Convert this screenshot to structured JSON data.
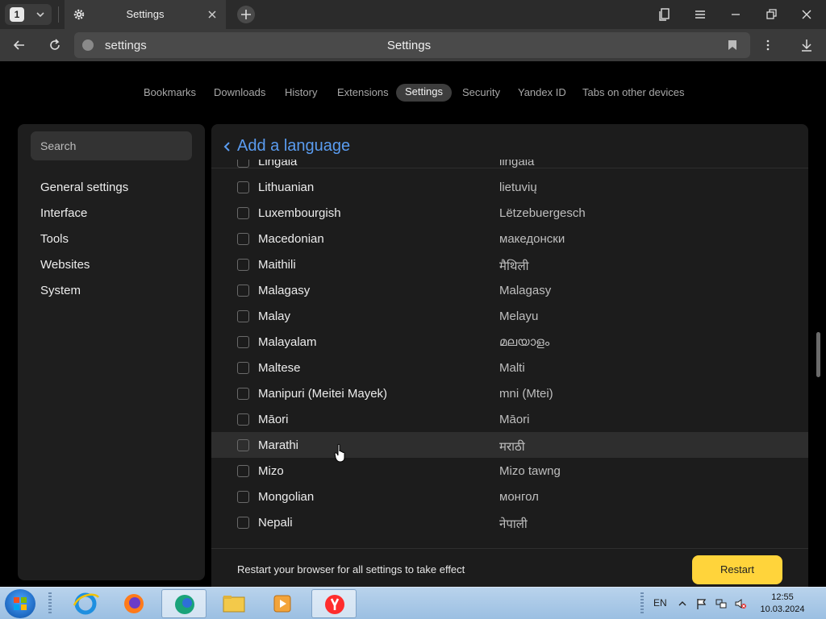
{
  "browser": {
    "tab_count": "1",
    "tab_title": "Settings",
    "url": "settings",
    "page_title": "Settings"
  },
  "topnav": {
    "items": [
      "Bookmarks",
      "Downloads",
      "History",
      "Extensions",
      "Settings",
      "Security",
      "Yandex ID",
      "Tabs on other devices"
    ],
    "active": "Settings"
  },
  "sidebar": {
    "search_placeholder": "Search",
    "items": [
      "General settings",
      "Interface",
      "Tools",
      "Websites",
      "System"
    ]
  },
  "main": {
    "header": "Add a language",
    "languages": [
      {
        "name": "Lingala",
        "native": "lingála",
        "checked": false
      },
      {
        "name": "Lithuanian",
        "native": "lietuvių",
        "checked": false
      },
      {
        "name": "Luxembourgish",
        "native": "Lëtzebuergesch",
        "checked": false
      },
      {
        "name": "Macedonian",
        "native": "македонски",
        "checked": false
      },
      {
        "name": "Maithili",
        "native": "मैथिली",
        "checked": false
      },
      {
        "name": "Malagasy",
        "native": "Malagasy",
        "checked": false
      },
      {
        "name": "Malay",
        "native": "Melayu",
        "checked": false
      },
      {
        "name": "Malayalam",
        "native": "മലയാളം",
        "checked": false
      },
      {
        "name": "Maltese",
        "native": "Malti",
        "checked": false
      },
      {
        "name": "Manipuri (Meitei Mayek)",
        "native": "mni (Mtei)",
        "checked": false
      },
      {
        "name": "Māori",
        "native": "Māori",
        "checked": false
      },
      {
        "name": "Marathi",
        "native": "मराठी",
        "checked": false,
        "hovered": true
      },
      {
        "name": "Mizo",
        "native": "Mizo tawng",
        "checked": false
      },
      {
        "name": "Mongolian",
        "native": "монгол",
        "checked": false
      },
      {
        "name": "Nepali",
        "native": "नेपाली",
        "checked": false
      }
    ],
    "footer_message": "Restart your browser for all settings to take effect",
    "restart_label": "Restart"
  },
  "taskbar": {
    "lang": "EN",
    "time": "12:55",
    "date": "10.03.2024",
    "apps": [
      "internet-explorer-icon",
      "firefox-icon",
      "edge-icon",
      "file-explorer-icon",
      "media-player-icon",
      "yandex-browser-icon"
    ]
  },
  "colors": {
    "accent_link": "#5a9cf0",
    "restart_button": "#ffd43b",
    "panel_bg": "#1c1c1c"
  }
}
